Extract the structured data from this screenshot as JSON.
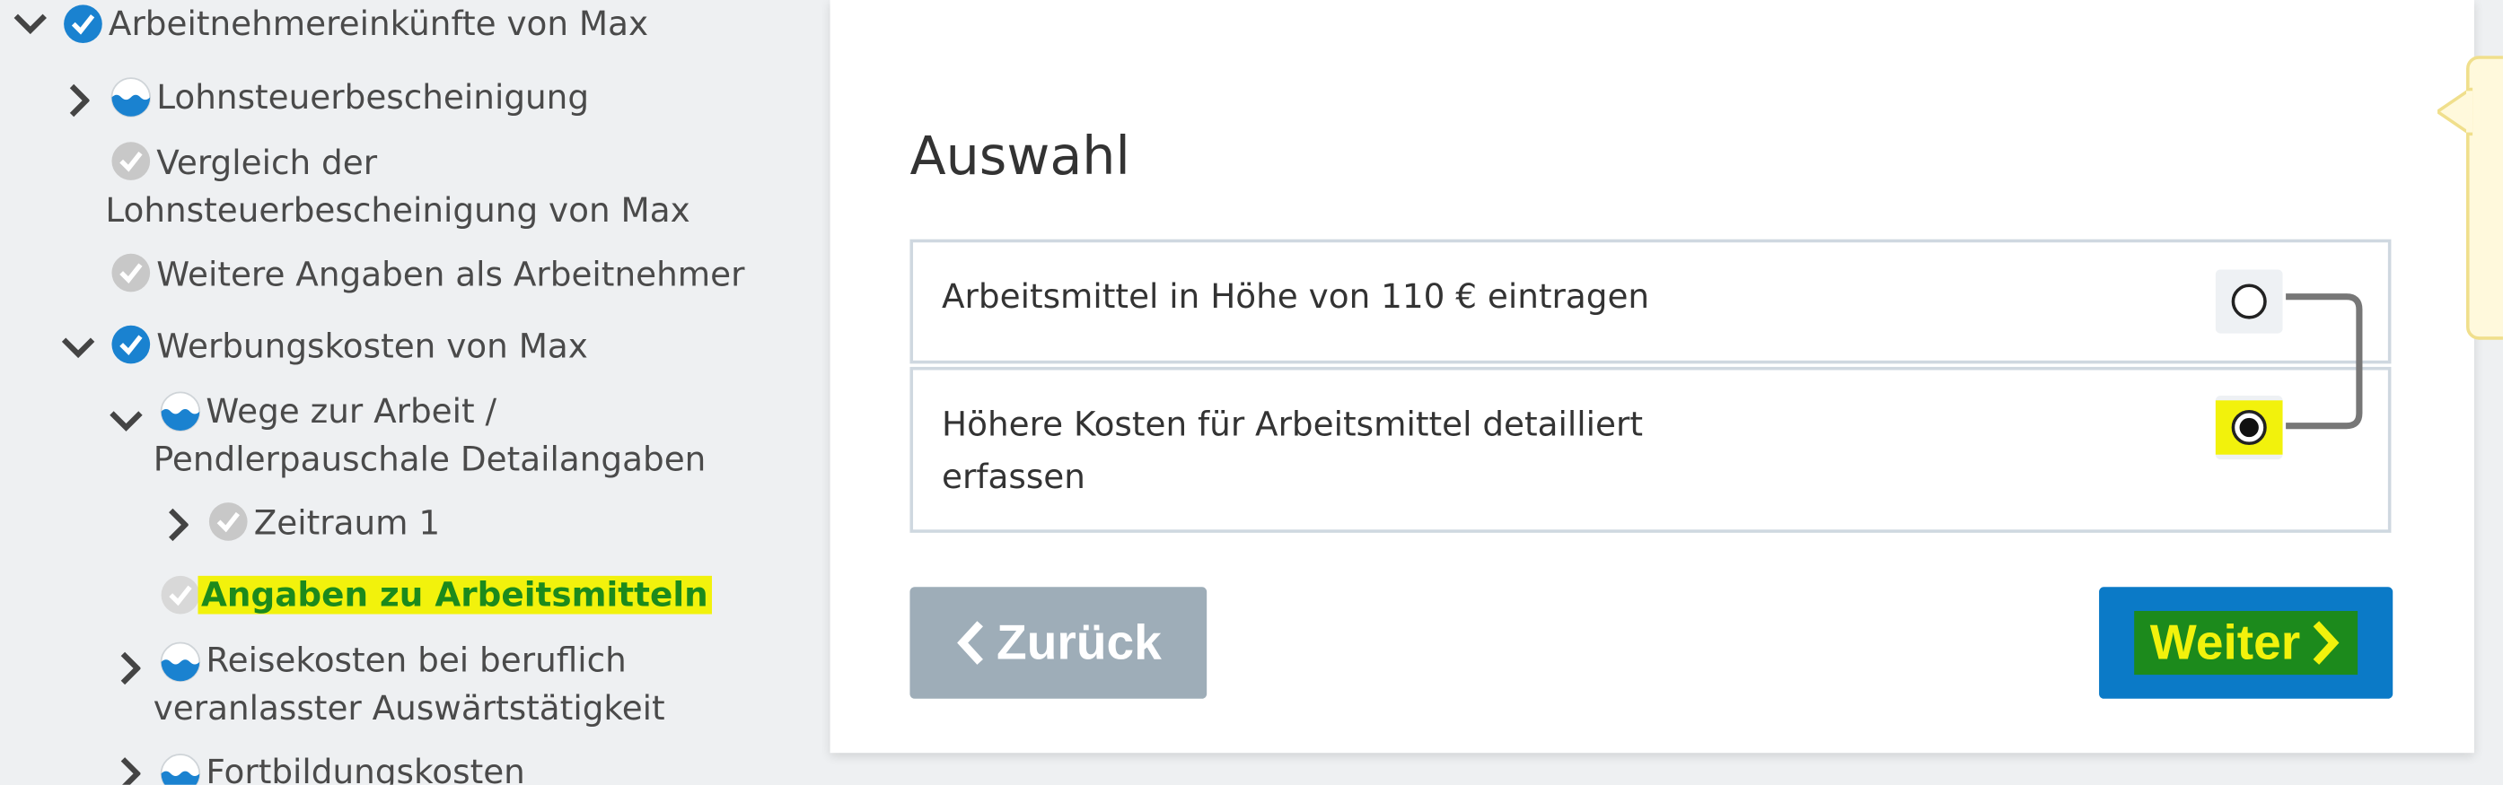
{
  "sidebar": {
    "items": [
      {
        "label": "Arbeitnehmereinkünfte von Max"
      },
      {
        "label": "Lohnsteuerbescheinigung"
      },
      {
        "label_line1": "Vergleich der",
        "label_line2": "Lohnsteuerbescheinigung von Max"
      },
      {
        "label": "Weitere Angaben als Arbeitnehmer"
      },
      {
        "label": "Werbungskosten von Max"
      },
      {
        "label_line1": "Wege zur Arbeit /",
        "label_line2": "Pendlerpauschale Detailangaben"
      },
      {
        "label": "Zeitraum 1"
      },
      {
        "label": "Angaben zu Arbeitsmitteln"
      },
      {
        "label_line1": "Reisekosten bei beruflich",
        "label_line2": "veranlasster Auswärtstätigkeit"
      },
      {
        "label": "Fortbildungskosten"
      }
    ]
  },
  "main": {
    "title": "Auswahl",
    "options": [
      {
        "label": "Arbeitsmittel in Höhe von 110 € eintragen",
        "selected": false
      },
      {
        "label_line1": "Höhere Kosten für Arbeitsmittel detailliert",
        "label_line2": "erfassen",
        "selected": true
      }
    ],
    "back_label": "Zurück",
    "next_label": "Weiter"
  },
  "colors": {
    "primary": "#0b7ac7",
    "back_button": "#9eadb8",
    "highlight_yellow": "#f2f20c",
    "highlight_green": "#1c8a1c",
    "status_check_blue": "#1a82d0",
    "status_check_gray": "#c8c8c8"
  },
  "icons": {
    "status_complete": "check-circle-blue-icon",
    "status_partial": "half-filled-circle-icon",
    "status_done_gray": "check-circle-gray-icon",
    "expand": "chevron-right-icon",
    "collapse": "chevron-down-icon",
    "back": "chevron-left-icon",
    "next": "chevron-right-icon"
  }
}
